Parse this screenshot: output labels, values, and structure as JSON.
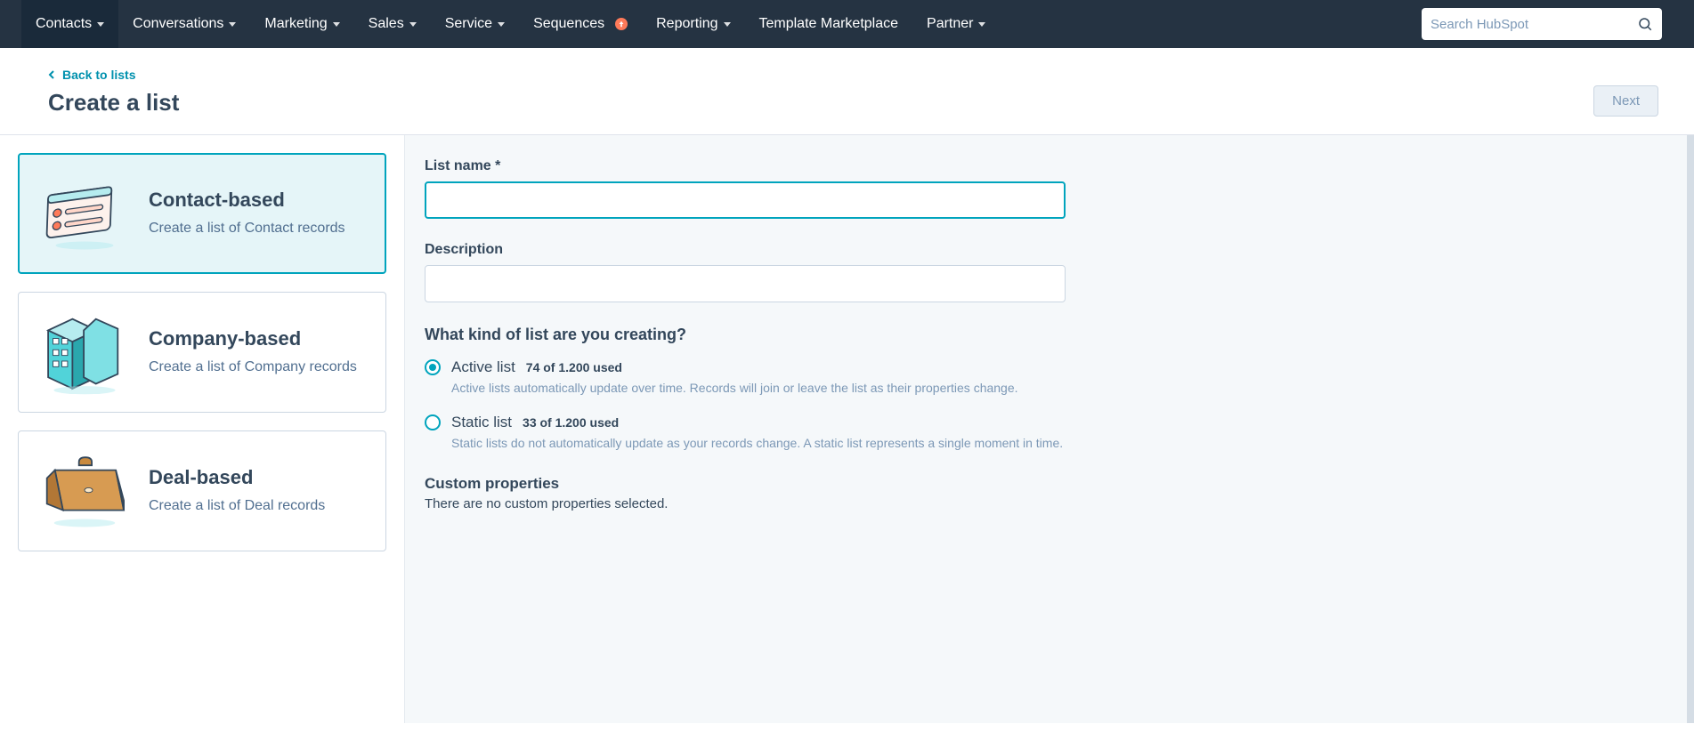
{
  "nav": {
    "items": [
      {
        "label": "Contacts",
        "has_caret": true,
        "active": true
      },
      {
        "label": "Conversations",
        "has_caret": true
      },
      {
        "label": "Marketing",
        "has_caret": true
      },
      {
        "label": "Sales",
        "has_caret": true
      },
      {
        "label": "Service",
        "has_caret": true
      },
      {
        "label": "Sequences",
        "has_caret": false,
        "badge": true
      },
      {
        "label": "Reporting",
        "has_caret": true
      },
      {
        "label": "Template Marketplace",
        "has_caret": false
      },
      {
        "label": "Partner",
        "has_caret": true
      }
    ],
    "search_placeholder": "Search HubSpot"
  },
  "header": {
    "back_label": "Back to lists",
    "title": "Create a list",
    "next_label": "Next"
  },
  "cards": [
    {
      "title": "Contact-based",
      "desc": "Create a list of Contact records",
      "icon": "contacts",
      "selected": true
    },
    {
      "title": "Company-based",
      "desc": "Create a list of Company records",
      "icon": "company",
      "selected": false
    },
    {
      "title": "Deal-based",
      "desc": "Create a list of Deal records",
      "icon": "deal",
      "selected": false
    }
  ],
  "form": {
    "name_label": "List name",
    "name_required": "*",
    "name_value": "",
    "desc_label": "Description",
    "desc_value": "",
    "kind_heading": "What kind of list are you creating?",
    "options": [
      {
        "label": "Active list",
        "usage": "74 of 1.200 used",
        "help": "Active lists automatically update over time. Records will join or leave the list as their properties change.",
        "checked": true
      },
      {
        "label": "Static list",
        "usage": "33 of 1.200 used",
        "help": "Static lists do not automatically update as your records change. A static list represents a single moment in time.",
        "checked": false
      }
    ],
    "custom_props_title": "Custom properties",
    "custom_props_empty": "There are no custom properties selected."
  }
}
